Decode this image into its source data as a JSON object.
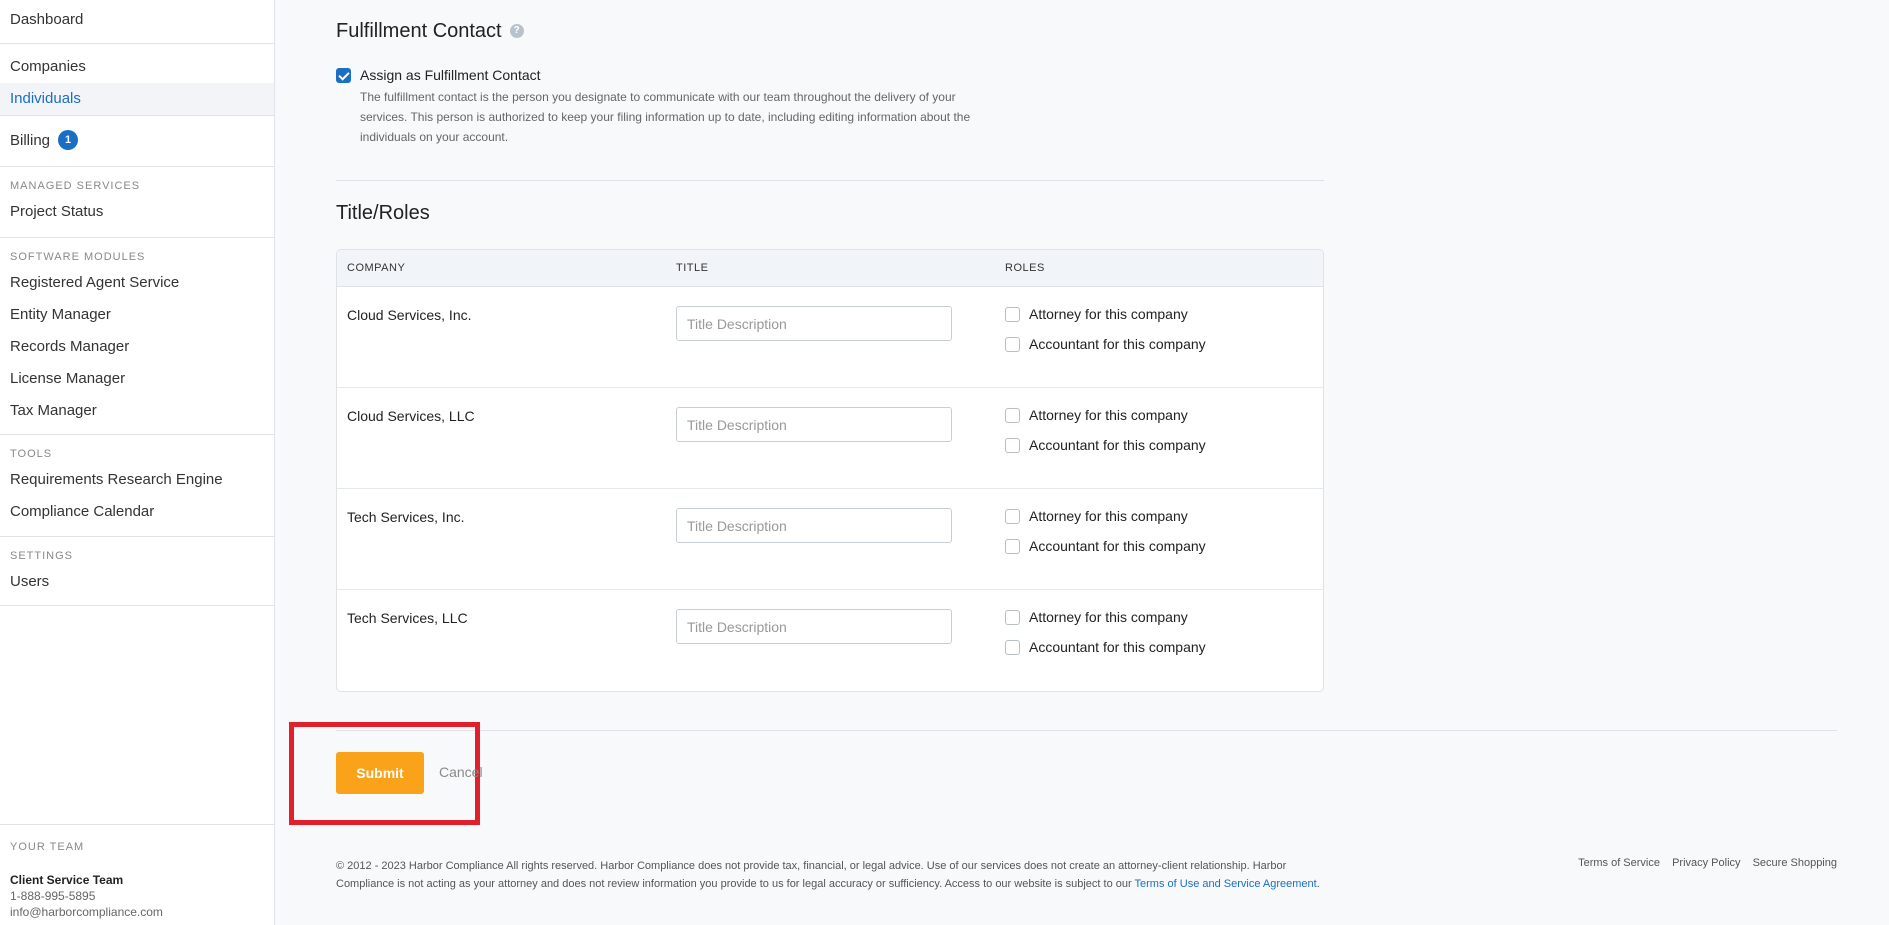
{
  "sidebar": {
    "dashboard": "Dashboard",
    "companies": "Companies",
    "individuals": "Individuals",
    "billing": "Billing",
    "billing_badge": "1",
    "managed_services_label": "MANAGED SERVICES",
    "project_status": "Project Status",
    "software_modules_label": "SOFTWARE MODULES",
    "registered_agent": "Registered Agent Service",
    "entity_manager": "Entity Manager",
    "records_manager": "Records Manager",
    "license_manager": "License Manager",
    "tax_manager": "Tax Manager",
    "tools_label": "TOOLS",
    "requirements_engine": "Requirements Research Engine",
    "compliance_calendar": "Compliance Calendar",
    "settings_label": "SETTINGS",
    "users": "Users"
  },
  "team": {
    "label": "YOUR TEAM",
    "name": "Client Service Team",
    "phone": "1-888-995-5895",
    "email": "info@harborcompliance.com"
  },
  "fulfillment": {
    "title": "Fulfillment Contact",
    "help_icon": "?",
    "checkbox_label": "Assign as Fulfillment Contact",
    "checked": true,
    "description": "The fulfillment contact is the person you designate to communicate with our team throughout the delivery of your services. This person is authorized to keep your filing information up to date, including editing information about the individuals on your account."
  },
  "roles": {
    "title": "Title/Roles",
    "headers": {
      "company": "COMPANY",
      "title": "TITLE",
      "roles": "ROLES"
    },
    "placeholder": "Title Description",
    "attorney_label": "Attorney for this company",
    "accountant_label": "Accountant for this company",
    "rows": [
      {
        "company": "Cloud Services, Inc."
      },
      {
        "company": "Cloud Services, LLC"
      },
      {
        "company": "Tech Services, Inc."
      },
      {
        "company": "Tech Services, LLC"
      }
    ]
  },
  "actions": {
    "submit": "Submit",
    "cancel": "Cancel",
    "highlight_color": "#e0202a",
    "submit_color": "#f9a21a"
  },
  "footer": {
    "text": "© 2012 - 2023 Harbor Compliance All rights reserved. Harbor Compliance does not provide tax, financial, or legal advice. Use of our services does not create an attorney-client relationship. Harbor Compliance is not acting as your attorney and does not review information you provide to us for legal accuracy or sufficiency. Access to our website is subject to our ",
    "terms_link": "Terms of Use and Service Agreement",
    "period": ".",
    "links": [
      "Terms of Service",
      "Privacy Policy",
      "Secure Shopping"
    ]
  }
}
